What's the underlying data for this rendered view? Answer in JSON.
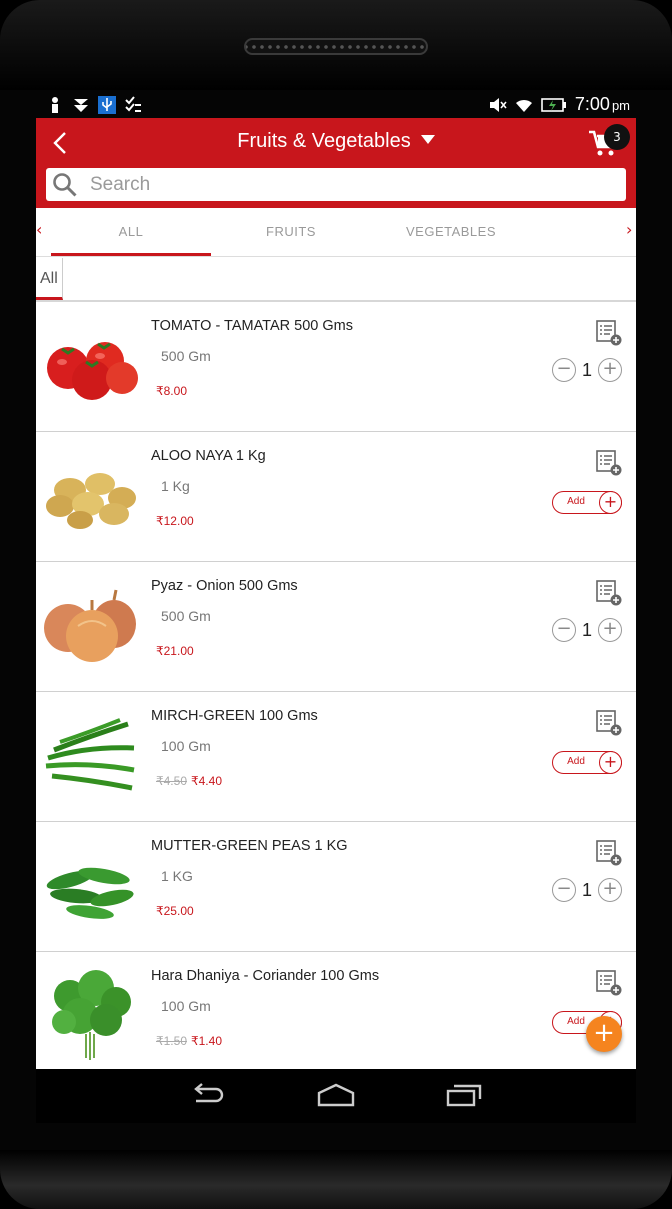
{
  "status_bar": {
    "time": "7:00",
    "ampm": "pm"
  },
  "app_bar": {
    "title": "Fruits & Vegetables",
    "cart_count": "3"
  },
  "search": {
    "placeholder": "Search"
  },
  "tabs": [
    {
      "label": "ALL",
      "active": true
    },
    {
      "label": "FRUITS",
      "active": false
    },
    {
      "label": "VEGETABLES",
      "active": false
    }
  ],
  "subtab": {
    "label": "All"
  },
  "products": [
    {
      "name": "TOMATO - TAMATAR 500 Gms",
      "unit": "500 Gm",
      "mrp": "",
      "price": "₹8.00",
      "control": "stepper",
      "qty": "1",
      "image": "tomato"
    },
    {
      "name": "ALOO NAYA 1 Kg",
      "unit": "1 Kg",
      "mrp": "",
      "price": "₹12.00",
      "control": "add",
      "add_label": "Add",
      "image": "potato"
    },
    {
      "name": "Pyaz - Onion 500 Gms",
      "unit": "500 Gm",
      "mrp": "",
      "price": "₹21.00",
      "control": "stepper",
      "qty": "1",
      "image": "onion"
    },
    {
      "name": "MIRCH-GREEN 100 Gms",
      "unit": "100 Gm",
      "mrp": "₹4.50",
      "price": "₹4.40",
      "control": "add",
      "add_label": "Add",
      "image": "green-chilli"
    },
    {
      "name": "MUTTER-GREEN PEAS 1 KG",
      "unit": "1 KG",
      "mrp": "",
      "price": "₹25.00",
      "control": "stepper",
      "qty": "1",
      "image": "green-peas"
    },
    {
      "name": "Hara Dhaniya - Coriander 100 Gms",
      "unit": "100 Gm",
      "mrp": "₹1.50",
      "price": "₹1.40",
      "control": "add",
      "add_label": "Add",
      "image": "coriander"
    }
  ],
  "colors": {
    "brand_red": "#c8161c",
    "fab_orange": "#f5841f"
  }
}
